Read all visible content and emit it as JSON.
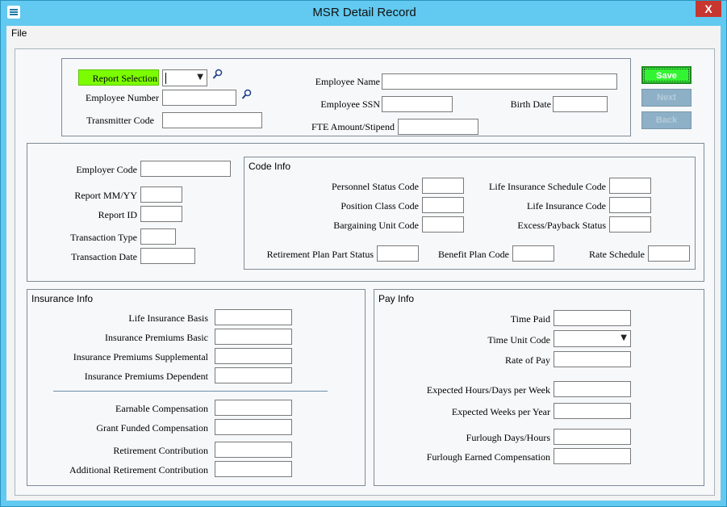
{
  "window": {
    "title": "MSR Detail Record",
    "close_label": "X"
  },
  "menu": {
    "items": [
      "File"
    ]
  },
  "buttons": {
    "save": "Save",
    "next": "Next",
    "back": "Back"
  },
  "header": {
    "report_selection": "Report Selection",
    "employee_number": "Employee  Number",
    "transmitter_code": "Transmitter Code",
    "employee_name": "Employee Name",
    "employee_ssn": "Employee SSN",
    "birth_date": "Birth Date",
    "fte_amount": "FTE Amount/Stipend"
  },
  "employer": {
    "employer_code": "Employer Code",
    "report_mmyy": "Report MM/YY",
    "report_id": "Report ID",
    "transaction_type": "Transaction Type",
    "transaction_date": "Transaction Date"
  },
  "code_info": {
    "title": "Code Info",
    "personnel_status_code": "Personnel Status Code",
    "position_class_code": "Position Class Code",
    "bargaining_unit_code": "Bargaining Unit Code",
    "life_insurance_schedule_code": "Life Insurance Schedule Code",
    "life_insurance_code": "Life Insurance Code",
    "excess_payback_status": "Excess/Payback Status",
    "retirement_plan_part_status": "Retirement Plan Part Status",
    "benefit_plan_code": "Benefit Plan Code",
    "rate_schedule": "Rate Schedule"
  },
  "insurance_info": {
    "title": "Insurance Info",
    "life_insurance_basis": "Life Insurance Basis",
    "insurance_premiums_basic": "Insurance Premiums Basic",
    "insurance_premiums_supplemental": "Insurance Premiums Supplemental",
    "insurance_premiums_dependent": "Insurance Premiums Dependent",
    "earnable_compensation": "Earnable Compensation",
    "grant_funded_compensation": "Grant Funded Compensation",
    "retirement_contribution": "Retirement Contribution",
    "additional_retirement_contribution": "Additional Retirement Contribution"
  },
  "pay_info": {
    "title": "Pay Info",
    "time_paid": "Time Paid",
    "time_unit_code": "Time Unit Code",
    "rate_of_pay": "Rate of Pay",
    "expected_hours_days_per_week": "Expected Hours/Days per Week",
    "expected_weeks_per_year": "Expected Weeks per Year",
    "furlough_days_hours": "Furlough Days/Hours",
    "furlough_earned_compensation": "Furlough Earned Compensation"
  },
  "colors": {
    "titlebar": "#62c9f0",
    "save_button": "#33f433",
    "report_selection_highlight": "#7cfc00"
  },
  "icons": {
    "app": "app-logo-icon",
    "lookup": "magnifier-icon",
    "dropdown": "chevron-down-icon"
  }
}
